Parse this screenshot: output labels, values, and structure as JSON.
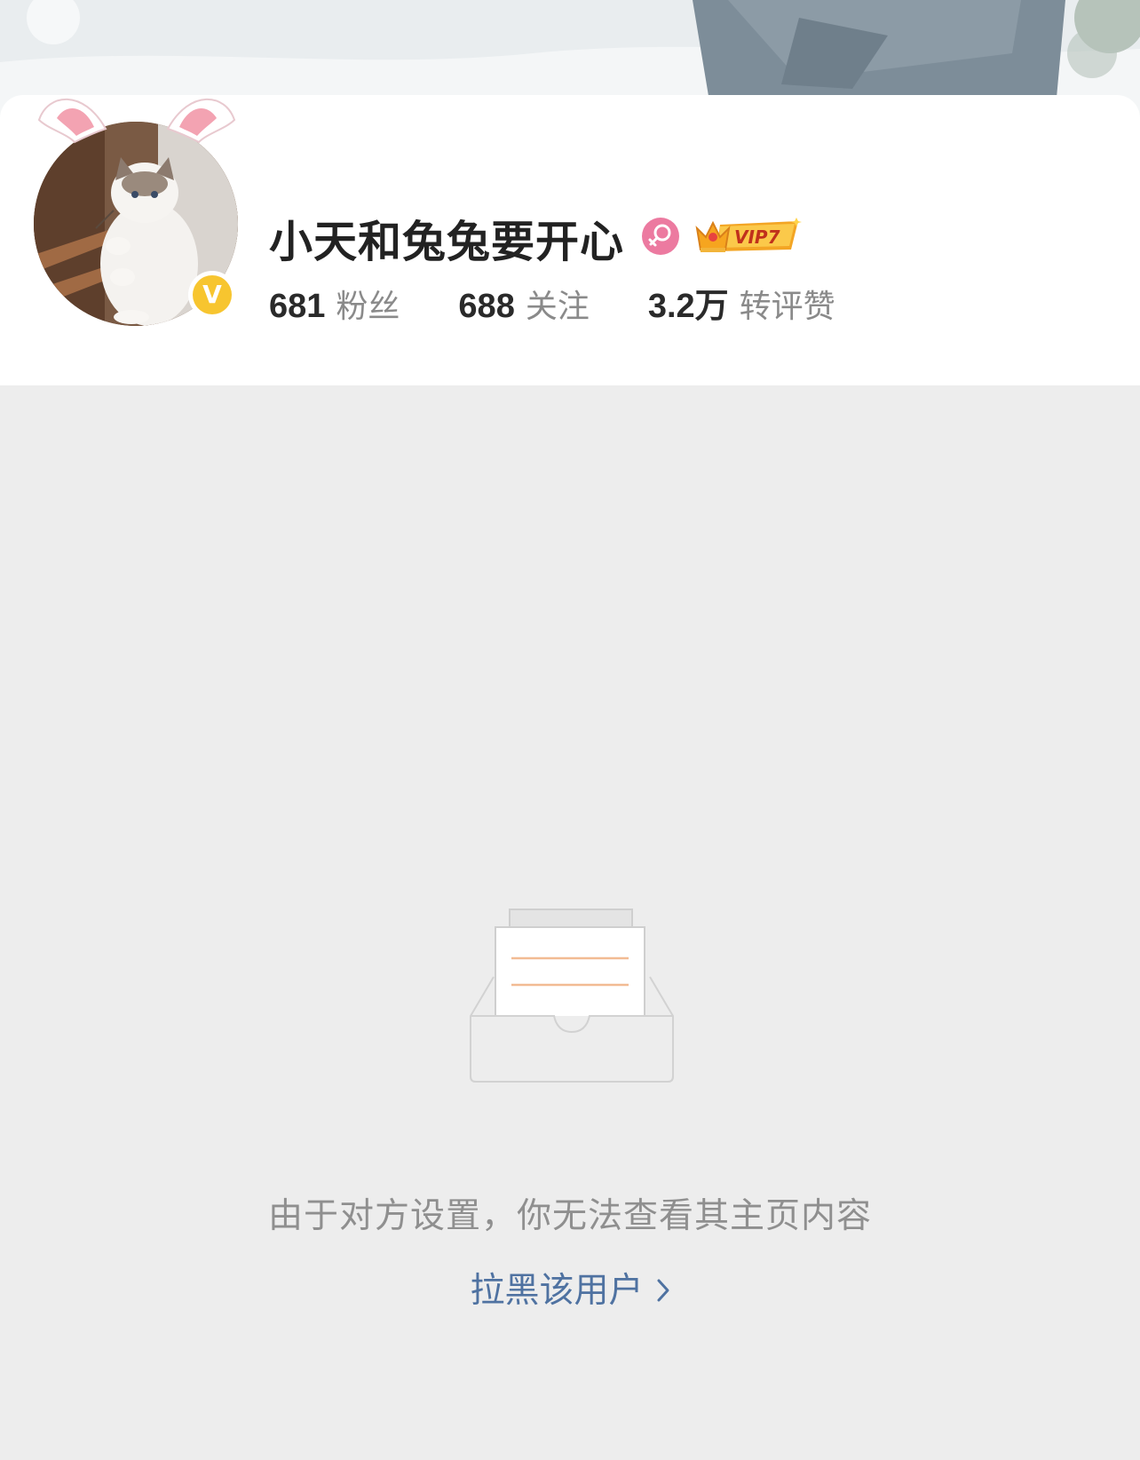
{
  "profile": {
    "username": "小天和兔兔要开心",
    "verified_mark": "V",
    "vip_label": "VIP7",
    "gender_icon": "female-icon"
  },
  "stats": [
    {
      "value": "681",
      "label": "粉丝"
    },
    {
      "value": "688",
      "label": "关注"
    },
    {
      "value": "3.2万",
      "label": "转评赞"
    }
  ],
  "empty_state": {
    "message": "由于对方设置，你无法查看其主页内容",
    "action_label": "拉黑该用户"
  },
  "colors": {
    "background": "#ededed",
    "card": "#ffffff",
    "link": "#4f72a1",
    "verified": "#f7c52f",
    "gender_badge": "#ec7aa0",
    "vip_gold": "#f3a524"
  }
}
